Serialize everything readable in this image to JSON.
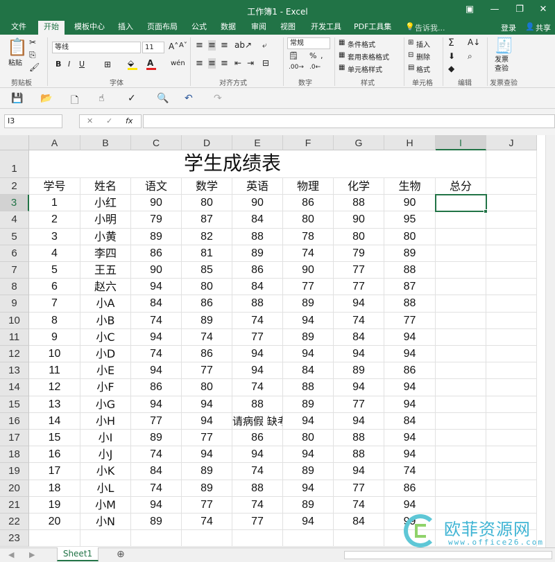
{
  "window": {
    "title": "工作簿1 - Excel",
    "controls": [
      "▣",
      "—",
      "❐",
      "✕"
    ]
  },
  "ribbon_tabs": [
    "文件",
    "开始",
    "模板中心",
    "插入",
    "页面布局",
    "公式",
    "数据",
    "审阅",
    "视图",
    "开发工具",
    "PDF工具集"
  ],
  "active_tab": "开始",
  "tell_me": "告诉我...",
  "login": "登录",
  "share": "共享",
  "ribbon": {
    "paste": "粘贴",
    "font_name": "等线",
    "font_size": "11",
    "number_format": "常规",
    "conditional_format": "条件格式",
    "table_format": "套用表格格式",
    "cell_style": "单元格样式",
    "insert": "插入",
    "delete": "删除",
    "format": "格式",
    "invoice_check": "发票\n查验",
    "groups": [
      "剪贴板",
      "字体",
      "对齐方式",
      "数字",
      "样式",
      "单元格",
      "编辑",
      "发票查验"
    ],
    "font_color": "#e02020",
    "fill_color": "#ffe600"
  },
  "name_box": "I3",
  "formula_value": "",
  "columns": [
    "A",
    "B",
    "C",
    "D",
    "E",
    "F",
    "G",
    "H",
    "I",
    "J"
  ],
  "selected_column": "I",
  "selected_row": 3,
  "sheet_title": "学生成绩表",
  "headers": [
    "学号",
    "姓名",
    "语文",
    "数学",
    "英语",
    "物理",
    "化学",
    "生物",
    "总分"
  ],
  "rows": [
    [
      "1",
      "小红",
      "90",
      "80",
      "90",
      "86",
      "88",
      "90"
    ],
    [
      "2",
      "小明",
      "79",
      "87",
      "84",
      "80",
      "90",
      "95"
    ],
    [
      "3",
      "小黄",
      "89",
      "82",
      "88",
      "78",
      "80",
      "80"
    ],
    [
      "4",
      "李四",
      "86",
      "81",
      "89",
      "74",
      "79",
      "89"
    ],
    [
      "5",
      "王五",
      "90",
      "85",
      "86",
      "90",
      "77",
      "88"
    ],
    [
      "6",
      "赵六",
      "94",
      "80",
      "84",
      "77",
      "77",
      "87"
    ],
    [
      "7",
      "小A",
      "84",
      "86",
      "88",
      "89",
      "94",
      "88"
    ],
    [
      "8",
      "小B",
      "74",
      "89",
      "74",
      "94",
      "74",
      "77"
    ],
    [
      "9",
      "小C",
      "94",
      "74",
      "77",
      "89",
      "84",
      "94"
    ],
    [
      "10",
      "小D",
      "74",
      "86",
      "94",
      "94",
      "94",
      "94"
    ],
    [
      "11",
      "小E",
      "94",
      "77",
      "94",
      "84",
      "89",
      "86"
    ],
    [
      "12",
      "小F",
      "86",
      "80",
      "74",
      "88",
      "94",
      "94"
    ],
    [
      "13",
      "小G",
      "94",
      "94",
      "88",
      "89",
      "77",
      "94"
    ],
    [
      "14",
      "小H",
      "77",
      "94",
      "请病假 缺考",
      "94",
      "94",
      "84"
    ],
    [
      "15",
      "小I",
      "89",
      "77",
      "86",
      "80",
      "88",
      "94"
    ],
    [
      "16",
      "小J",
      "74",
      "94",
      "94",
      "94",
      "88",
      "94"
    ],
    [
      "17",
      "小K",
      "84",
      "89",
      "74",
      "89",
      "94",
      "74"
    ],
    [
      "18",
      "小L",
      "74",
      "89",
      "88",
      "94",
      "77",
      "86"
    ],
    [
      "19",
      "小M",
      "94",
      "77",
      "74",
      "89",
      "74",
      "94"
    ],
    [
      "20",
      "小N",
      "89",
      "74",
      "77",
      "94",
      "84",
      "99"
    ]
  ],
  "row_numbers": [
    "1",
    "2",
    "3",
    "4",
    "5",
    "6",
    "7",
    "8",
    "9",
    "10",
    "11",
    "12",
    "13",
    "14",
    "15",
    "16",
    "17",
    "18",
    "19",
    "20",
    "21",
    "22",
    "23"
  ],
  "sheet_tab": "Sheet1",
  "add_sheet": "⊕",
  "watermark": {
    "text": "欧菲资源网",
    "url": "www.office26.com"
  }
}
